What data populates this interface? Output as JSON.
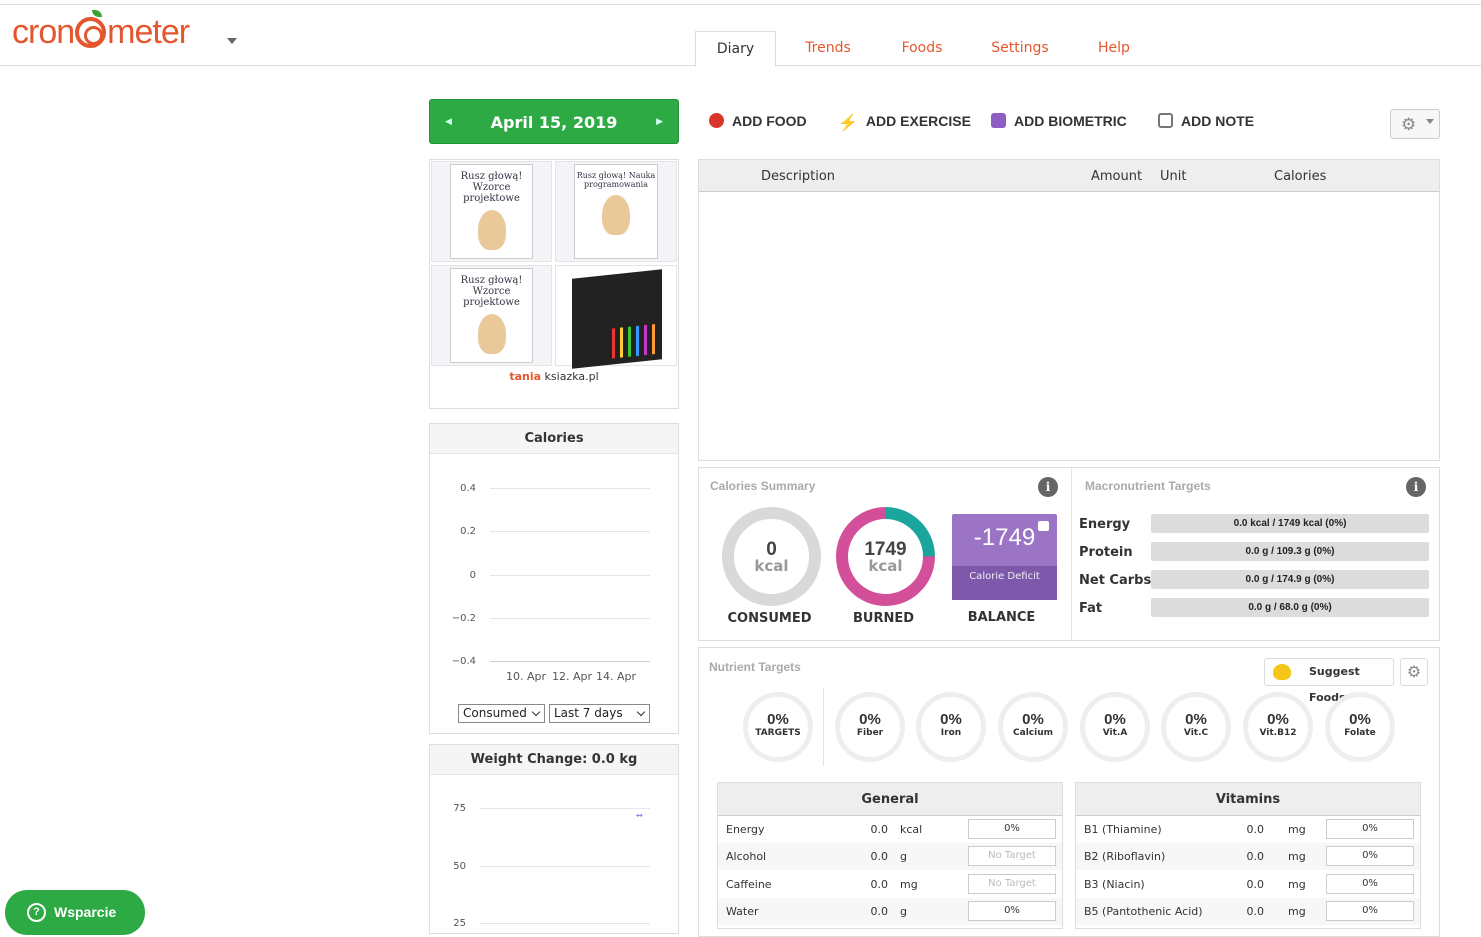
{
  "app": {
    "logo_text_left": "cron",
    "logo_text_right": "meter"
  },
  "tabs": [
    {
      "label": "Diary",
      "active": true
    },
    {
      "label": "Trends"
    },
    {
      "label": "Foods"
    },
    {
      "label": "Settings"
    },
    {
      "label": "Help"
    }
  ],
  "date": {
    "label": "April 15, 2019"
  },
  "ad": {
    "books": [
      "Rusz głową! Wzorce projektowe",
      "Rusz głową! Nauka programowania",
      "Rusz głową! Wzorce projektowe"
    ],
    "brand_top": "tania",
    "brand_bottom": "ksiazka.pl"
  },
  "actions": [
    {
      "label": "ADD FOOD",
      "icon": "apple-icon",
      "color": "#d9352b"
    },
    {
      "label": "ADD EXERCISE",
      "icon": "runner-icon",
      "color": "#1e88e5"
    },
    {
      "label": "ADD BIOMETRIC",
      "icon": "bag-icon",
      "color": "#8e5cc2"
    },
    {
      "label": "ADD NOTE",
      "icon": "note-icon",
      "color": "#777777"
    }
  ],
  "diary_table": {
    "columns": [
      "Description",
      "Amount",
      "Unit",
      "Calories"
    ]
  },
  "calories_chart": {
    "title": "Calories",
    "y_ticks": [
      "0.4",
      "0.2",
      "0",
      "−0.2",
      "−0.4"
    ],
    "x_ticks": [
      "10. Apr",
      "12. Apr",
      "14. Apr"
    ],
    "select_metric": "Consumed",
    "select_range": "Last 7 days"
  },
  "weight_chart": {
    "title": "Weight Change: 0.0 kg",
    "y_ticks": [
      "75",
      "50",
      "25"
    ]
  },
  "calories_summary": {
    "title": "Calories Summary",
    "consumed": {
      "value": "0",
      "unit": "kcal",
      "label": "CONSUMED"
    },
    "burned": {
      "value": "1749",
      "unit": "kcal",
      "label": "BURNED"
    },
    "balance": {
      "value": "-1749",
      "sub": "Calorie Deficit",
      "label": "BALANCE"
    }
  },
  "macro_targets": {
    "title": "Macronutrient Targets",
    "rows": [
      {
        "name": "Energy",
        "value": "0.0 kcal / 1749 kcal (0%)"
      },
      {
        "name": "Protein",
        "value": "0.0 g / 109.3 g (0%)"
      },
      {
        "name": "Net Carbs",
        "value": "0.0 g / 174.9 g (0%)"
      },
      {
        "name": "Fat",
        "value": "0.0 g / 68.0 g (0%)"
      }
    ]
  },
  "nutrient_targets": {
    "title": "Nutrient Targets",
    "suggest_label": "Suggest Foods",
    "circles": [
      {
        "pct": "0%",
        "label": "TARGETS"
      },
      {
        "pct": "0%",
        "label": "Fiber"
      },
      {
        "pct": "0%",
        "label": "Iron"
      },
      {
        "pct": "0%",
        "label": "Calcium"
      },
      {
        "pct": "0%",
        "label": "Vit.A"
      },
      {
        "pct": "0%",
        "label": "Vit.C"
      },
      {
        "pct": "0%",
        "label": "Vit.B12"
      },
      {
        "pct": "0%",
        "label": "Folate"
      }
    ]
  },
  "general": {
    "title": "General",
    "rows": [
      {
        "name": "Energy",
        "value": "0.0",
        "unit": "kcal",
        "pct": "0%"
      },
      {
        "name": "Alcohol",
        "value": "0.0",
        "unit": "g",
        "pct": "No Target"
      },
      {
        "name": "Caffeine",
        "value": "0.0",
        "unit": "mg",
        "pct": "No Target"
      },
      {
        "name": "Water",
        "value": "0.0",
        "unit": "g",
        "pct": "0%"
      }
    ]
  },
  "vitamins": {
    "title": "Vitamins",
    "rows": [
      {
        "name": "B1 (Thiamine)",
        "value": "0.0",
        "unit": "mg",
        "pct": "0%"
      },
      {
        "name": "B2 (Riboflavin)",
        "value": "0.0",
        "unit": "mg",
        "pct": "0%"
      },
      {
        "name": "B3 (Niacin)",
        "value": "0.0",
        "unit": "mg",
        "pct": "0%"
      },
      {
        "name": "B5 (Pantothenic Acid)",
        "value": "0.0",
        "unit": "mg",
        "pct": "0%"
      }
    ]
  },
  "support": {
    "label": "Wsparcie"
  }
}
